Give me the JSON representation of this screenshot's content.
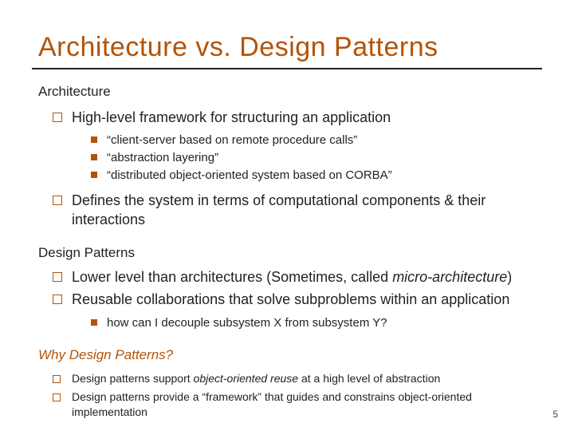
{
  "title": "Architecture vs. Design Patterns",
  "sections": {
    "arch": {
      "label": "Architecture",
      "items": [
        {
          "text": "High-level framework for structuring an application",
          "sub": [
            "“client-server based on remote procedure calls”",
            "“abstraction layering”",
            "“distributed object-oriented system based on CORBA”"
          ]
        },
        {
          "text": "Defines the system in terms of computational components & their interactions"
        }
      ]
    },
    "dp": {
      "label": "Design Patterns",
      "items": [
        {
          "pre": "Lower level than architectures (Sometimes, called ",
          "italic": "micro-architecture",
          "post": ")"
        },
        {
          "text": "Reusable collaborations that solve subproblems within an application",
          "sub": [
            "how can I decouple subsystem X from subsystem Y?"
          ]
        }
      ]
    },
    "why": {
      "label": "Why Design Patterns?",
      "items": [
        {
          "pre": "Design patterns support ",
          "italic": "object-oriented reuse",
          "post": " at a high level of abstraction"
        },
        {
          "text": "Design patterns provide a “framework” that guides and constrains object-oriented implementation"
        }
      ]
    }
  },
  "pagenum": "5"
}
